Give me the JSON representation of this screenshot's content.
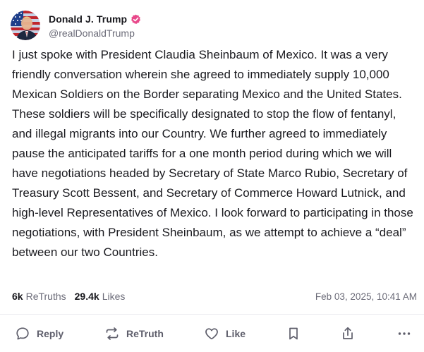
{
  "author": {
    "display_name": "Donald J. Trump",
    "handle": "@realDonaldTrump",
    "verified_badge_icon": "verified-check-icon",
    "verified_color": "#e8488a",
    "avatar_icon": "american-flag-portrait-avatar"
  },
  "post": {
    "text": "I just spoke with President Claudia Sheinbaum of Mexico. It was a very friendly conversation wherein she agreed to immediately supply 10,000 Mexican Soldiers on the Border separating Mexico and the United States. These soldiers will be specifically designated to stop the flow of fentanyl, and illegal migrants into our Country. We further agreed to immediately pause the anticipated tariffs for a one month period during which we will have negotiations headed by Secretary of State Marco Rubio, Secretary of Treasury Scott Bessent, and Secretary of Commerce Howard Lutnick, and high-level Representatives of Mexico. I look forward to participating in those negotiations, with President Sheinbaum, as we attempt to achieve a “deal” between our two Countries."
  },
  "stats": {
    "retruths_count": "6k",
    "retruths_label": "ReTruths",
    "likes_count": "29.4k",
    "likes_label": "Likes",
    "timestamp": "Feb 03, 2025, 10:41 AM"
  },
  "actions": {
    "reply_label": "Reply",
    "retruth_label": "ReTruth",
    "like_label": "Like",
    "reply_icon": "speech-bubble-icon",
    "retruth_icon": "repost-arrows-icon",
    "like_icon": "heart-icon",
    "bookmark_icon": "bookmark-icon",
    "share_icon": "share-upload-icon",
    "more_icon": "more-dots-icon"
  },
  "colors": {
    "text_primary": "#1a1a1f",
    "text_secondary": "#6b6b78",
    "divider": "#ececf0"
  }
}
